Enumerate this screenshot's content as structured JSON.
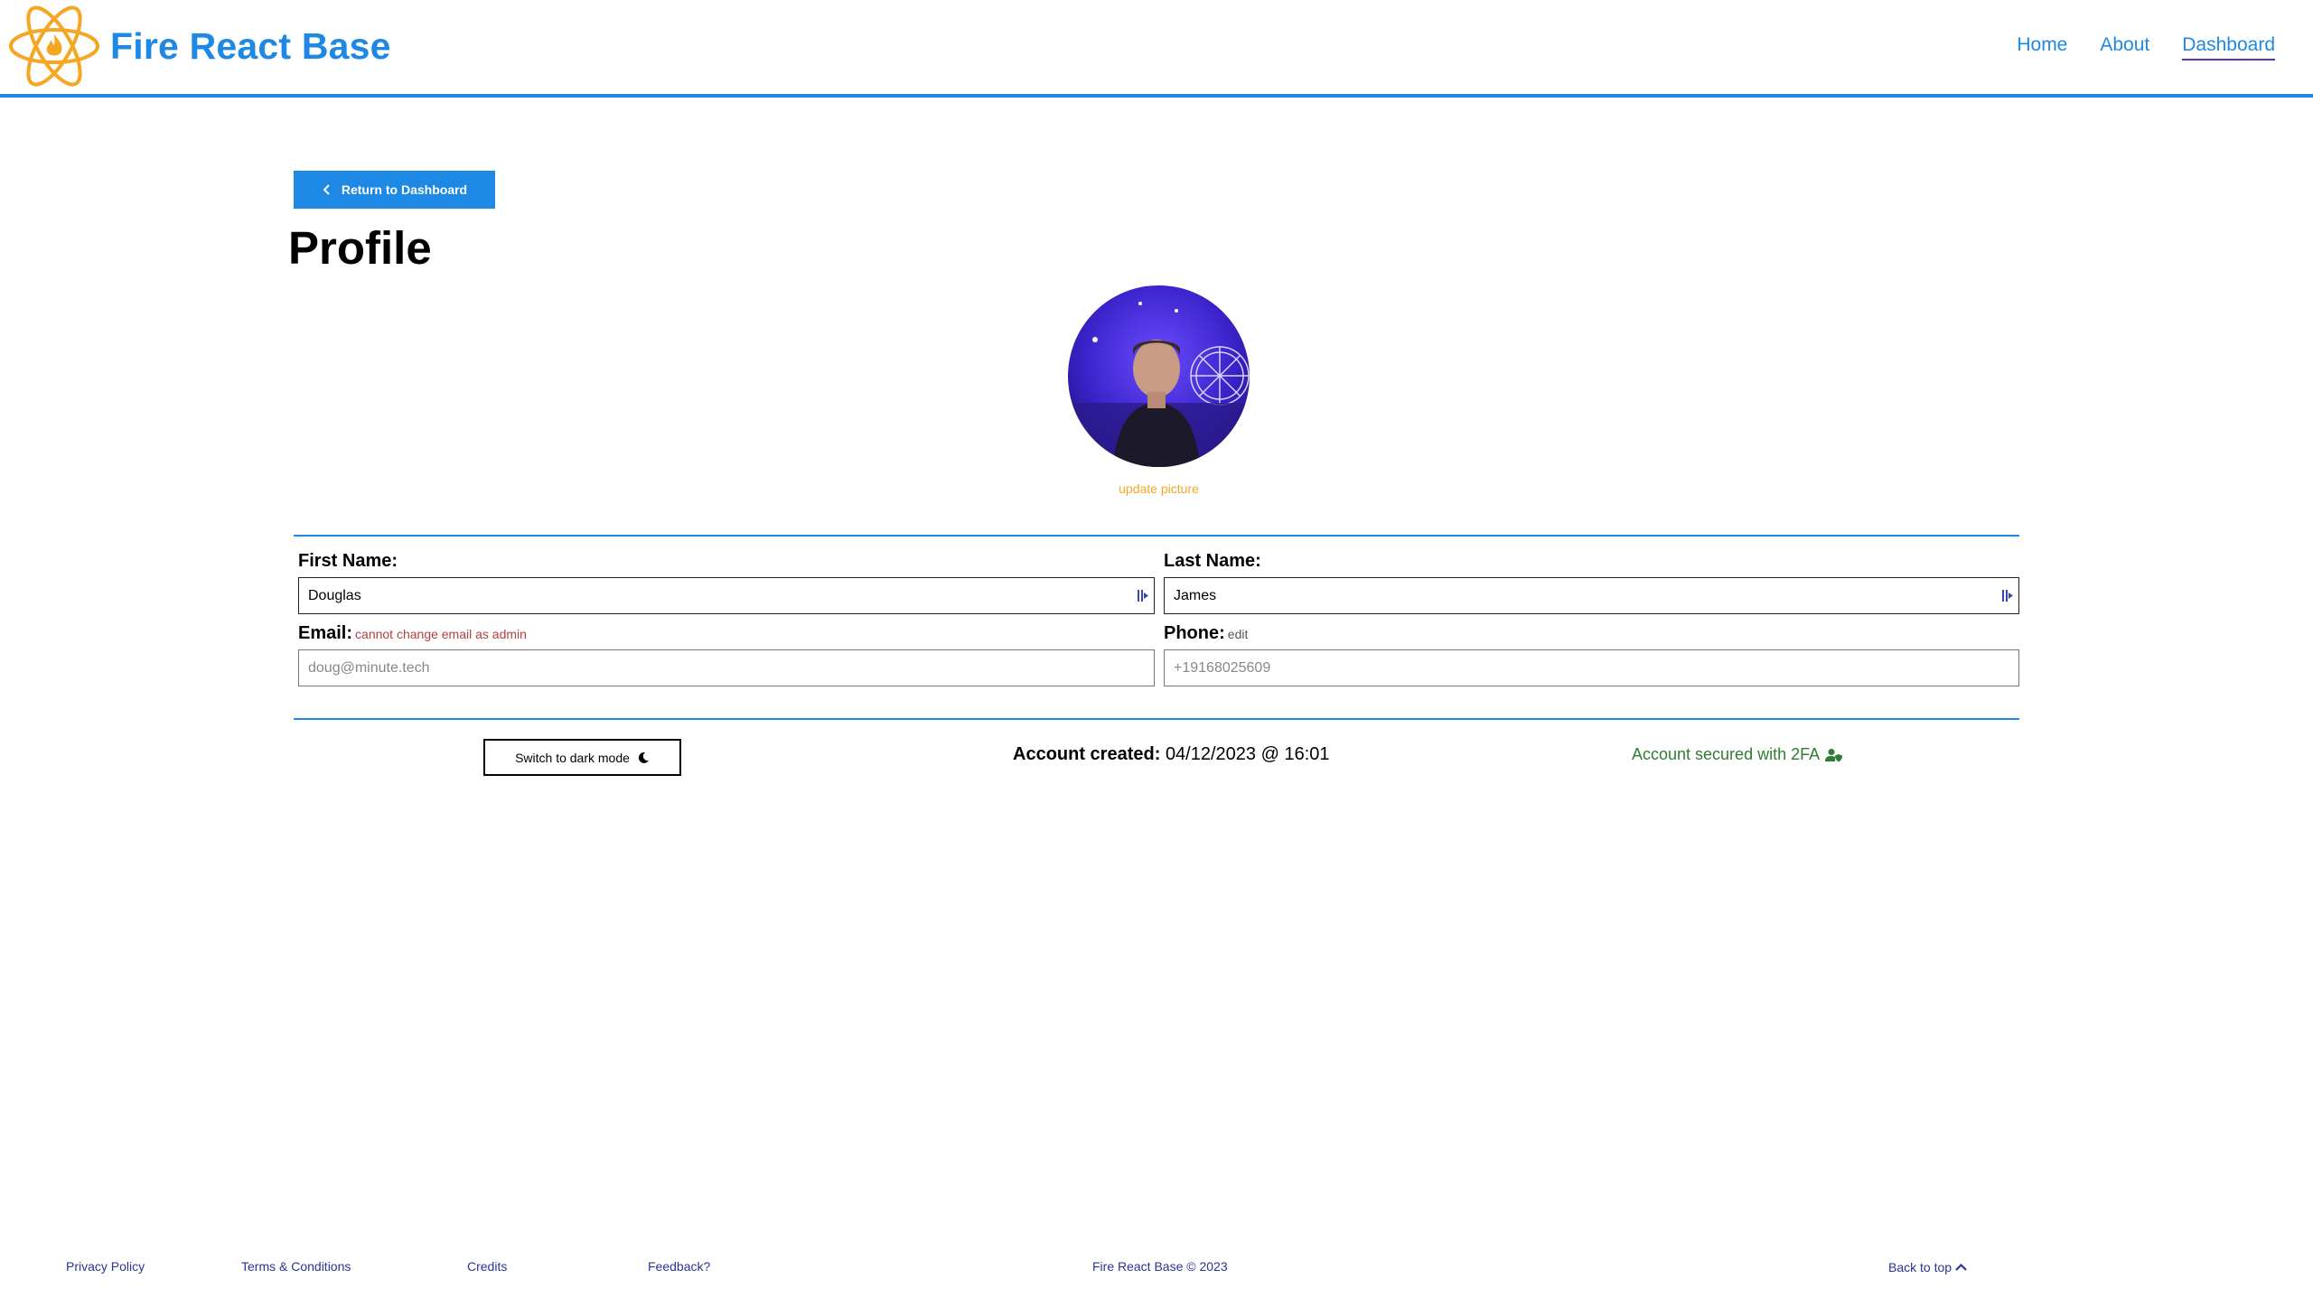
{
  "header": {
    "brand_name": "Fire React Base",
    "logo_icon": "atom-flame-logo",
    "nav": [
      {
        "label": "Home"
      },
      {
        "label": "About"
      },
      {
        "label": "Dashboard",
        "active": true
      }
    ]
  },
  "main": {
    "return_button_label": "Return to Dashboard",
    "page_title": "Profile",
    "avatar_icon": "profile-photo",
    "update_picture_label": "update picture",
    "fields": {
      "first_name": {
        "label": "First Name:",
        "value": "Douglas"
      },
      "last_name": {
        "label": "Last Name:",
        "value": "James"
      },
      "email": {
        "label": "Email:",
        "hint": "cannot change email as admin",
        "value": "doug@minute.tech"
      },
      "phone": {
        "label": "Phone:",
        "hint": "edit",
        "value": "+19168025609"
      }
    },
    "dark_mode_label": "Switch to dark mode",
    "account_created_label": "Account created:",
    "account_created_value": "04/12/2023 @ 16:01",
    "twofa_label": "Account secured with 2FA"
  },
  "footer": {
    "links": [
      "Privacy Policy",
      "Terms & Conditions",
      "Credits",
      "Feedback?"
    ],
    "copyright": "Fire React Base © 2023",
    "back_to_top": "Back to top"
  },
  "colors": {
    "brand_blue": "#1e88e5",
    "logo_orange": "#f5a623",
    "nav_active_underline": "#5e35b1",
    "error_red": "#b0413e",
    "success_green": "#2e7d32",
    "footer_text": "#283593"
  }
}
